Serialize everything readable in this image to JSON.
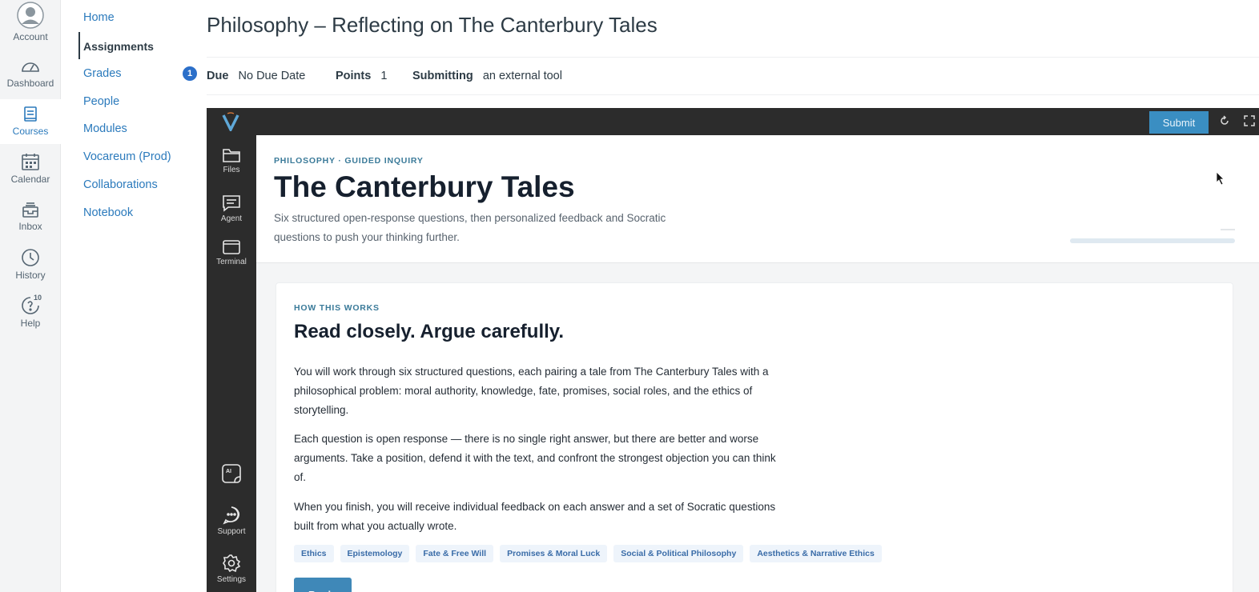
{
  "global_nav": {
    "items": [
      {
        "label": "Account",
        "icon": "avatar-icon"
      },
      {
        "label": "Dashboard",
        "icon": "dashboard-icon"
      },
      {
        "label": "Courses",
        "icon": "book-icon"
      },
      {
        "label": "Calendar",
        "icon": "calendar-icon"
      },
      {
        "label": "Inbox",
        "icon": "inbox-icon"
      },
      {
        "label": "History",
        "icon": "clock-icon"
      },
      {
        "label": "Help",
        "icon": "help-icon",
        "badge": "10"
      }
    ],
    "active": "Courses"
  },
  "course_nav": {
    "items": [
      {
        "label": "Home"
      },
      {
        "label": "Assignments"
      },
      {
        "label": "Grades"
      },
      {
        "label": "People"
      },
      {
        "label": "Modules"
      },
      {
        "label": "Vocareum (Prod)"
      },
      {
        "label": "Collaborations"
      },
      {
        "label": "Notebook"
      }
    ],
    "active": "Assignments"
  },
  "assignment": {
    "title": "Philosophy – Reflecting on The Canterbury Tales",
    "badge": "1",
    "due_label": "Due",
    "due_value": "No Due Date",
    "points_label": "Points",
    "points_value": "1",
    "submitting_label": "Submitting",
    "submitting_value": "an external tool"
  },
  "tool": {
    "submit_label": "Submit",
    "sidebar": [
      {
        "label": "Files",
        "icon": "folder-icon"
      },
      {
        "label": "Agent",
        "icon": "chat-icon"
      },
      {
        "label": "Terminal",
        "icon": "terminal-icon"
      },
      {
        "label": "",
        "icon": "ai-icon"
      },
      {
        "label": "Support",
        "icon": "support-icon"
      },
      {
        "label": "Settings",
        "icon": "gear-icon"
      }
    ],
    "hero": {
      "eyebrow": "PHILOSOPHY · GUIDED INQUIRY",
      "title": "The Canterbury Tales",
      "subtitle": "Six structured open-response questions, then personalized feedback and Socratic questions to push your thinking further."
    },
    "card": {
      "eyebrow": "HOW THIS WORKS",
      "title": "Read closely. Argue carefully.",
      "paragraphs": [
        "You will work through six structured questions, each pairing a tale from The Canterbury Tales with a philosophical problem: moral authority, knowledge, fate, promises, social roles, and the ethics of storytelling.",
        "Each question is open response — there is no single right answer, but there are better and worse arguments. Take a position, defend it with the text, and confront the strongest objection you can think of.",
        "When you finish, you will receive individual feedback on each answer and a set of Socratic questions built from what you actually wrote."
      ],
      "tags": [
        "Ethics",
        "Epistemology",
        "Fate & Free Will",
        "Promises & Moral Luck",
        "Social & Political Philosophy",
        "Aesthetics & Narrative Ethics"
      ],
      "begin_label": "Begin"
    }
  },
  "colors": {
    "link": "#2b7abc",
    "tool_bar": "#2c2c2c",
    "submit": "#3a8ec2",
    "eyebrow": "#3a7a99",
    "tag_bg": "#eef4fb"
  }
}
